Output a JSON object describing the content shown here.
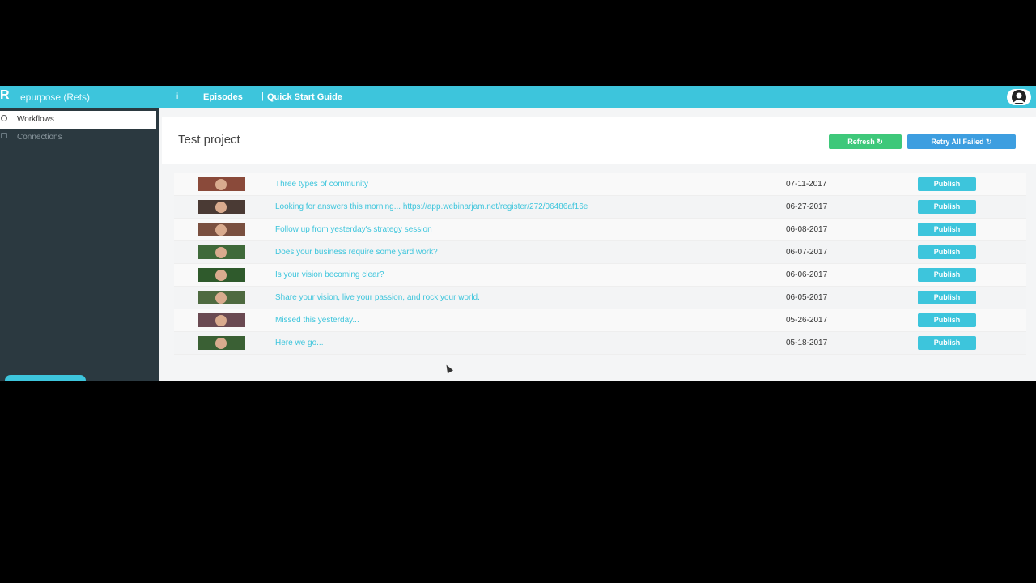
{
  "topbar": {
    "logo": "R",
    "brand": "epurpose (Rets)",
    "info": "i",
    "nav_episodes": "Episodes",
    "nav_separator": "|",
    "nav_guide": "Quick Start Guide"
  },
  "sidebar": {
    "items": [
      {
        "label": "Workflows",
        "icon": "circle-icon",
        "active": true
      },
      {
        "label": "Connections",
        "icon": "link-icon",
        "active": false
      }
    ]
  },
  "page": {
    "title": "Test project",
    "refresh_label": "Refresh ↻",
    "retry_label": "Retry All Failed ↻"
  },
  "episodes": [
    {
      "title": "Three types of community",
      "date": "07-11-2017",
      "action": "Publish",
      "thumb_bg": "#8a4a3a"
    },
    {
      "title": "Looking for answers this morning... https://app.webinarjam.net/register/272/06486af16e",
      "date": "06-27-2017",
      "action": "Publish",
      "thumb_bg": "#4a3a34"
    },
    {
      "title": "Follow up from yesterday's strategy session",
      "date": "06-08-2017",
      "action": "Publish",
      "thumb_bg": "#7a5040"
    },
    {
      "title": "Does your business require some yard work?",
      "date": "06-07-2017",
      "action": "Publish",
      "thumb_bg": "#3f6a3a"
    },
    {
      "title": "Is your vision becoming clear?",
      "date": "06-06-2017",
      "action": "Publish",
      "thumb_bg": "#2f5a2c"
    },
    {
      "title": "Share your vision, live your passion, and rock your world.",
      "date": "06-05-2017",
      "action": "Publish",
      "thumb_bg": "#4e6a40"
    },
    {
      "title": "Missed this yesterday...",
      "date": "05-26-2017",
      "action": "Publish",
      "thumb_bg": "#6a4a52"
    },
    {
      "title": "Here we go...",
      "date": "05-18-2017",
      "action": "Publish",
      "thumb_bg": "#3a6034"
    }
  ],
  "colors": {
    "accent": "#3dc5dc",
    "refresh": "#3ec87a",
    "retry": "#3d9ee0",
    "sidebar": "#2b3940"
  }
}
